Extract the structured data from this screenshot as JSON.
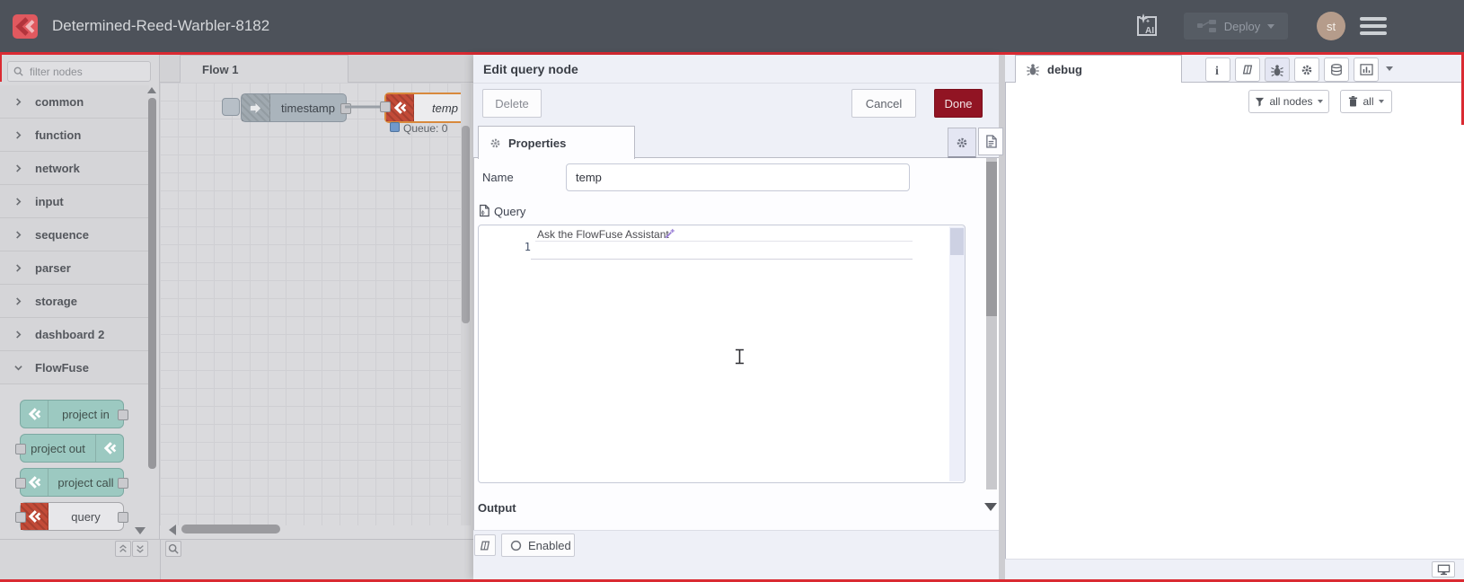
{
  "header": {
    "title": "Determined-Reed-Warbler-8182",
    "ai_label": "AI",
    "deploy_label": "Deploy",
    "avatar_initials": "st"
  },
  "palette": {
    "filter_placeholder": "filter nodes",
    "categories": [
      "common",
      "function",
      "network",
      "input",
      "sequence",
      "parser",
      "storage",
      "dashboard 2",
      "FlowFuse"
    ],
    "flowfuse_nodes": [
      "project in",
      "project out",
      "project call",
      "query"
    ]
  },
  "workspace": {
    "tab_label": "Flow 1",
    "inject_node_label": "timestamp",
    "query_node_label": "temp",
    "query_node_status": "Queue: 0"
  },
  "tray": {
    "title": "Edit query node",
    "delete_label": "Delete",
    "cancel_label": "Cancel",
    "done_label": "Done",
    "properties_tab": "Properties",
    "name_label": "Name",
    "name_value": "temp",
    "query_label": "Query",
    "editor_line_number": "1",
    "assistant_placeholder": "Ask the FlowFuse Assistant",
    "output_label": "Output",
    "enabled_label": "Enabled"
  },
  "debug": {
    "tab_label": "debug",
    "filter_label": "all nodes",
    "clear_label": "all"
  },
  "colors": {
    "header_bg": "#4d525a",
    "accent_red": "#da2a32",
    "done_button_bg": "#911423",
    "selected_node_border": "#d8893c",
    "teal_node": "#9cc9c1",
    "flowfuse_red": "#c34b38",
    "status_blue": "#7099cb",
    "active_icon_bg": "#e4e6f3"
  }
}
